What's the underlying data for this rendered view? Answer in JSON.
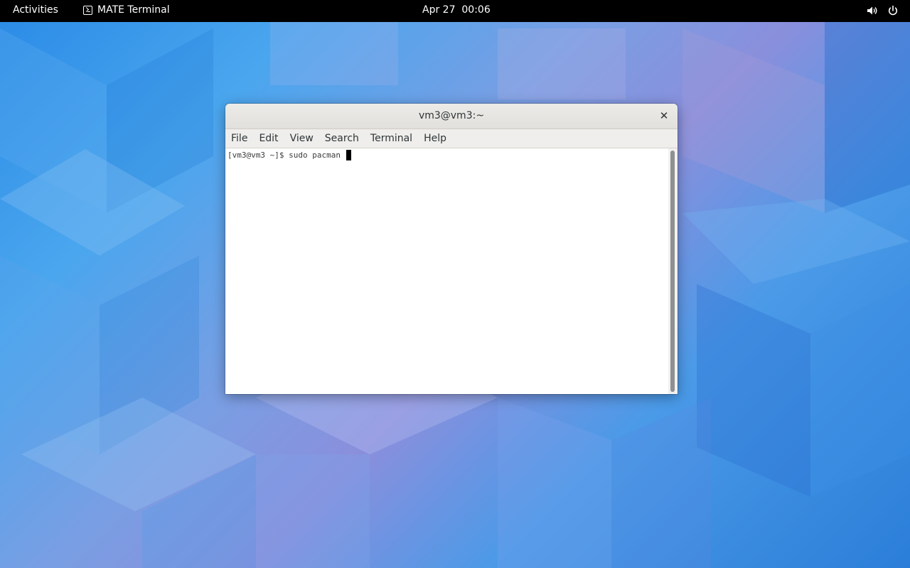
{
  "topbar": {
    "activities_label": "Activities",
    "app_name": "MATE Terminal",
    "app_icon": "terminal-icon",
    "clock": "Apr 27  00:06",
    "volume_icon": "speaker-icon",
    "power_icon": "power-icon"
  },
  "window": {
    "title": "vm3@vm3:~",
    "close_glyph": "✕",
    "menus": [
      "File",
      "Edit",
      "View",
      "Search",
      "Terminal",
      "Help"
    ],
    "terminal": {
      "prompt": "[vm3@vm3 ~]$ ",
      "command": "sudo pacman "
    }
  },
  "colors": {
    "topbar_bg": "#000000",
    "titlebar_bg": "#e6e4e1",
    "terminal_bg": "#ffffff",
    "wallpaper_primary": "#3b8ee0"
  }
}
